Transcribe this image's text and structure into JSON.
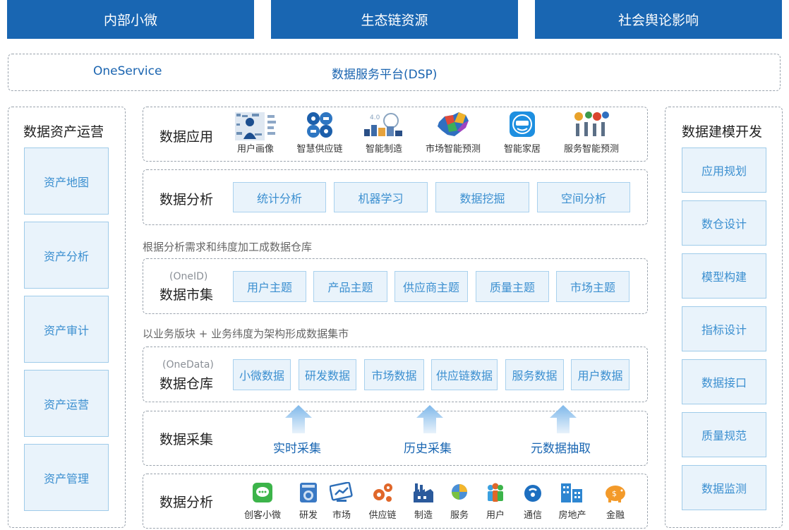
{
  "top_tabs": [
    "内部小微",
    "生态链资源",
    "社会舆论影响"
  ],
  "service_bar": {
    "left": "OneService",
    "center": "数据服务平台(DSP)"
  },
  "left_panel": {
    "title": "数据资产运营",
    "items": [
      "资产地图",
      "资产分析",
      "资产审计",
      "资产运营",
      "资产管理"
    ]
  },
  "right_panel": {
    "title": "数据建模开发",
    "items": [
      "应用规划",
      "数仓设计",
      "模型构建",
      "指标设计",
      "数据接口",
      "质量规范",
      "数据监测"
    ]
  },
  "apps_row": {
    "title": "数据应用",
    "items": [
      {
        "label": "用户画像",
        "icon": "user-portrait-icon"
      },
      {
        "label": "智慧供应链",
        "icon": "smart-supply-chain-icon"
      },
      {
        "label": "智能制造",
        "icon": "smart-manufacturing-icon"
      },
      {
        "label": "市场智能预测",
        "icon": "market-map-icon"
      },
      {
        "label": "智能家居",
        "icon": "smart-home-icon"
      },
      {
        "label": "服务智能预测",
        "icon": "service-gears-icon"
      }
    ]
  },
  "analysis_row": {
    "title": "数据分析",
    "chips": [
      "统计分析",
      "机器学习",
      "数据挖掘",
      "空间分析"
    ]
  },
  "note1": "根据分析需求和纬度加工成数据仓库",
  "mart_row": {
    "sub": "(OneID)",
    "title": "数据市集",
    "chips": [
      "用户主题",
      "产品主题",
      "供应商主题",
      "质量主题",
      "市场主题"
    ]
  },
  "note2": "以业务版块 + 业务纬度为架构形成数据集市",
  "warehouse_row": {
    "sub": "(OneData)",
    "title": "数据仓库",
    "chips": [
      "小微数据",
      "研发数据",
      "市场数据",
      "供应链数据",
      "服务数据",
      "用户数据"
    ]
  },
  "collect_row": {
    "title": "数据采集",
    "items": [
      "实时采集",
      "历史采集",
      "元数据抽取"
    ]
  },
  "source_row": {
    "title": "数据分析",
    "items": [
      {
        "label": "创客小微",
        "icon": "chat-icon",
        "color": "#3cb44a"
      },
      {
        "label": "研发",
        "icon": "washer-icon",
        "color": "#3a79c4"
      },
      {
        "label": "市场",
        "icon": "chart-screen-icon",
        "color": "#2f6fb8"
      },
      {
        "label": "供应链",
        "icon": "gears-icon",
        "color": "#e0672a"
      },
      {
        "label": "制造",
        "icon": "factory-icon",
        "color": "#2b5a9c"
      },
      {
        "label": "服务",
        "icon": "service-icon",
        "color": "#4a8fd6"
      },
      {
        "label": "用户",
        "icon": "users-icon",
        "color": "#3aa0e0"
      },
      {
        "label": "通信",
        "icon": "signal-icon",
        "color": "#1d6fc0"
      },
      {
        "label": "房地产",
        "icon": "building-icon",
        "color": "#2e86d1"
      },
      {
        "label": "金融",
        "icon": "piggy-bank-icon",
        "color": "#f39a2a"
      }
    ]
  }
}
